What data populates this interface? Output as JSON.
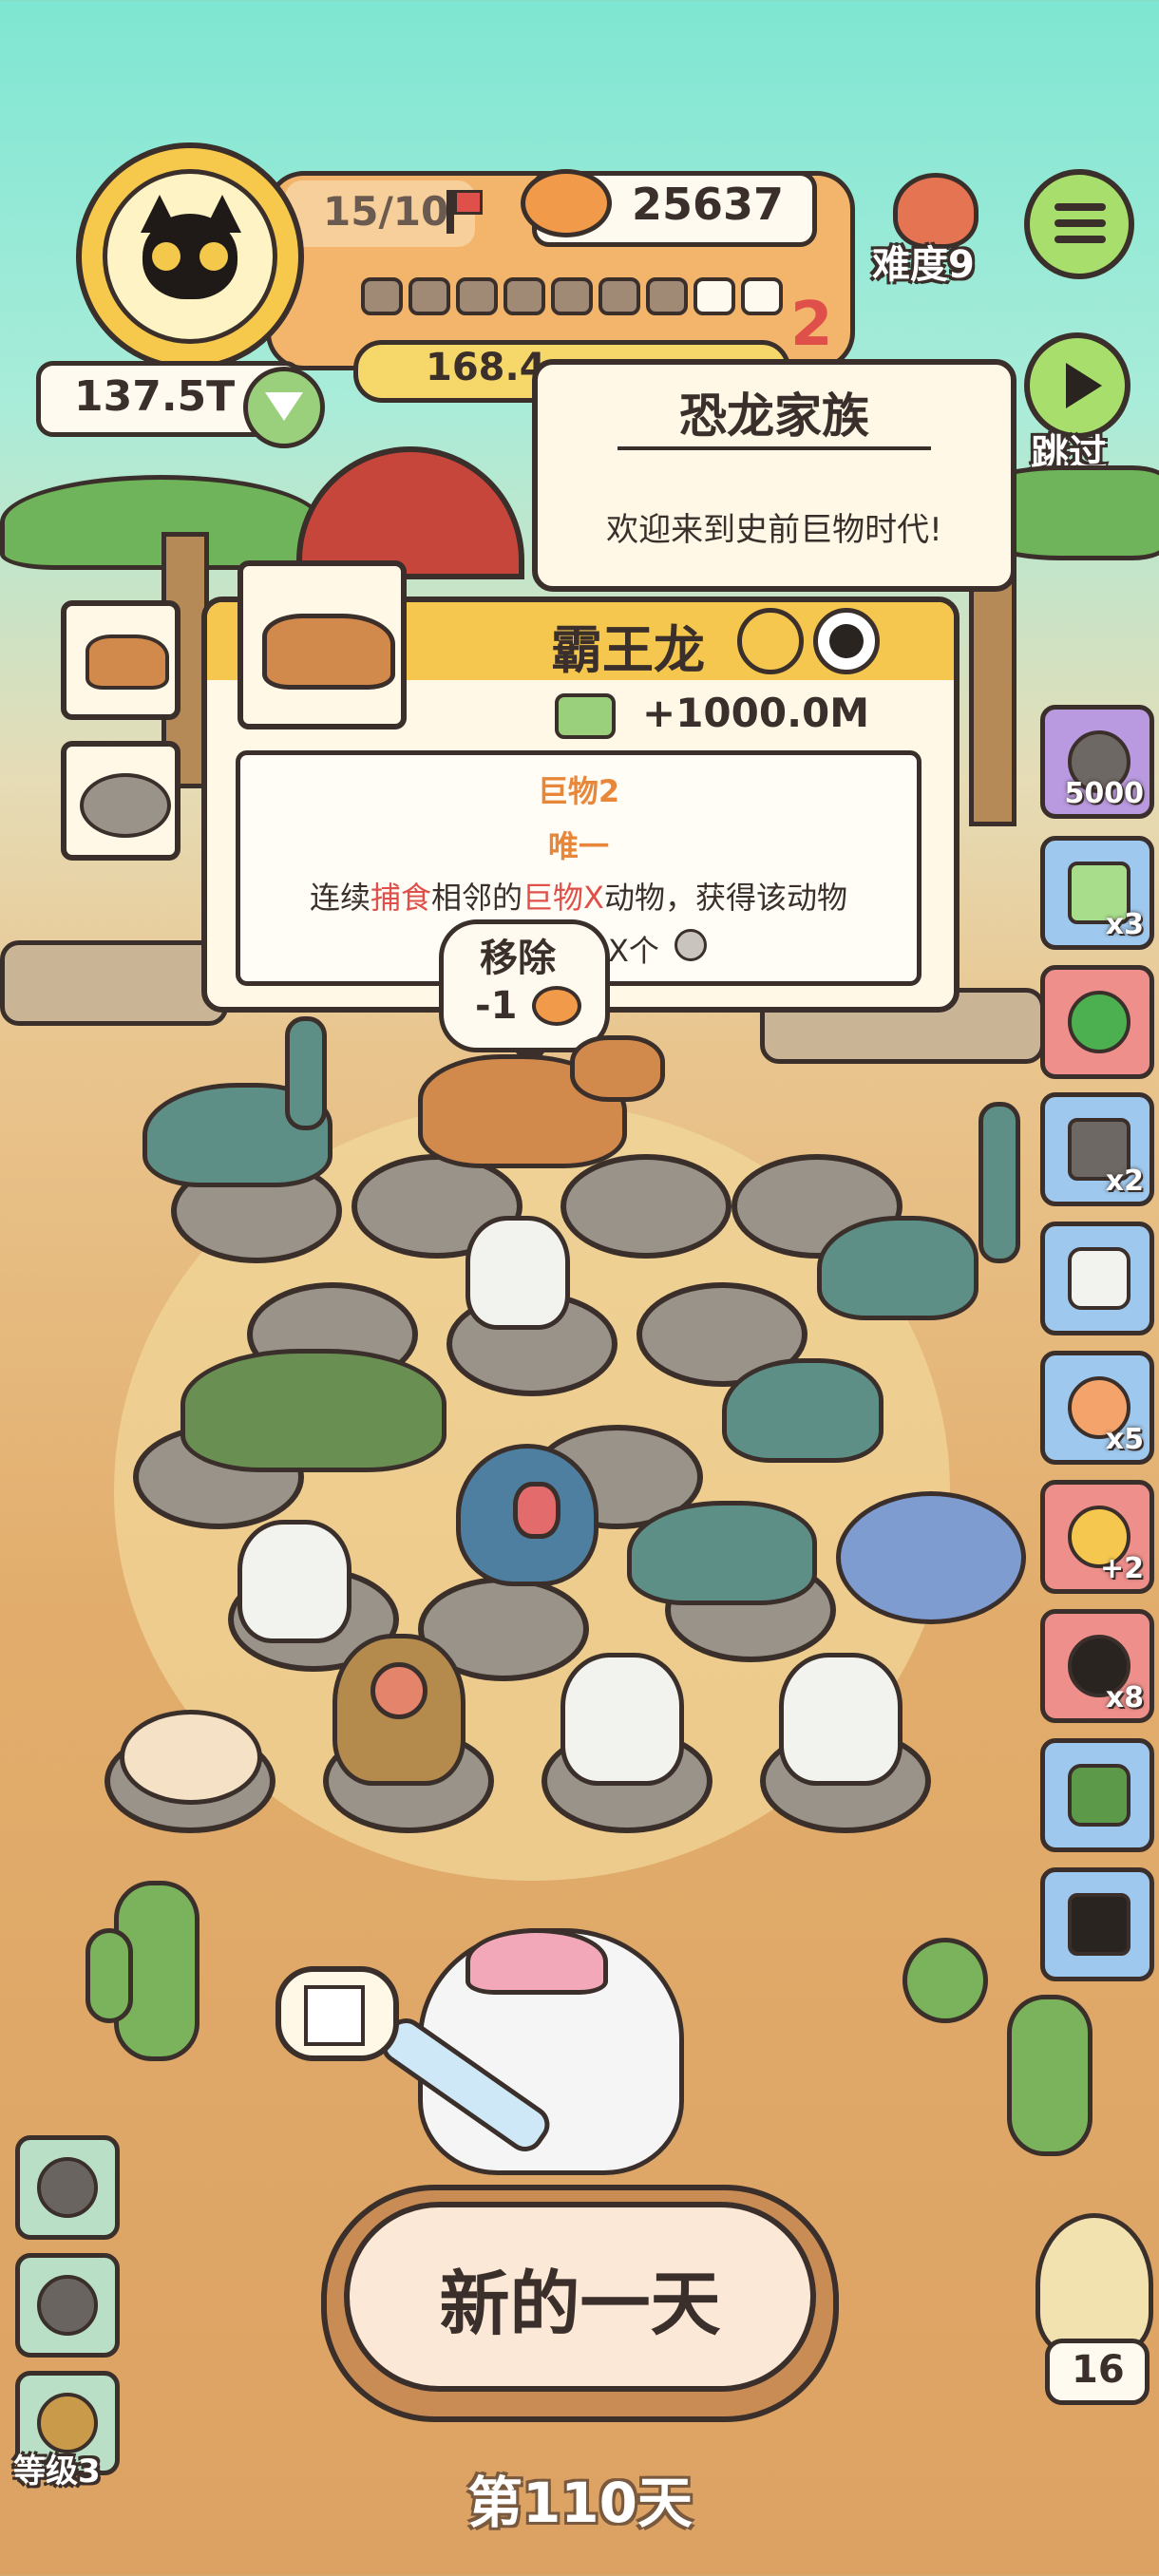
{
  "hud": {
    "money": "137.5T",
    "population": "15/10",
    "cans": "25637",
    "progress_text": "168.4",
    "level_badge": "2",
    "difficulty": "难度9",
    "skip_label": "跳过"
  },
  "intro_popup": {
    "title": "恐龙家族",
    "subtitle": "欢迎来到史前巨物时代!"
  },
  "card": {
    "name": "霸王龙",
    "income": "+1000.0M",
    "tag": "巨物2",
    "rarity": "唯一",
    "desc_1": "连续",
    "desc_2": "捕食",
    "desc_3": "相邻的",
    "desc_4": "巨物X",
    "desc_5": "动物，获得该动物",
    "desc_line2": "X个"
  },
  "remove_bubble": {
    "label": "移除",
    "cost": "-1"
  },
  "inventory": [
    {
      "name": "stone-egg",
      "count": "5000"
    },
    {
      "name": "lucky-ticket",
      "count": "x3"
    },
    {
      "name": "green-orb",
      "count": ""
    },
    {
      "name": "tin-can",
      "count": "x2"
    },
    {
      "name": "potion-jar",
      "count": ""
    },
    {
      "name": "donut",
      "count": "x5"
    },
    {
      "name": "plus-egg",
      "count": "+2"
    },
    {
      "name": "bomb",
      "count": "x8"
    },
    {
      "name": "herb-pot",
      "count": ""
    },
    {
      "name": "camera",
      "count": ""
    }
  ],
  "bottom": {
    "new_day_label": "新的一天",
    "day_label": "第110天",
    "level_label": "等级3",
    "counter": "16"
  },
  "colors": {
    "ink": "#3a2f2a",
    "panel": "#fff8e7",
    "accent_orange": "#f3b56b",
    "gold": "#f6c94c",
    "red_highlight": "#e0504a",
    "orange_text": "#e8873a"
  }
}
